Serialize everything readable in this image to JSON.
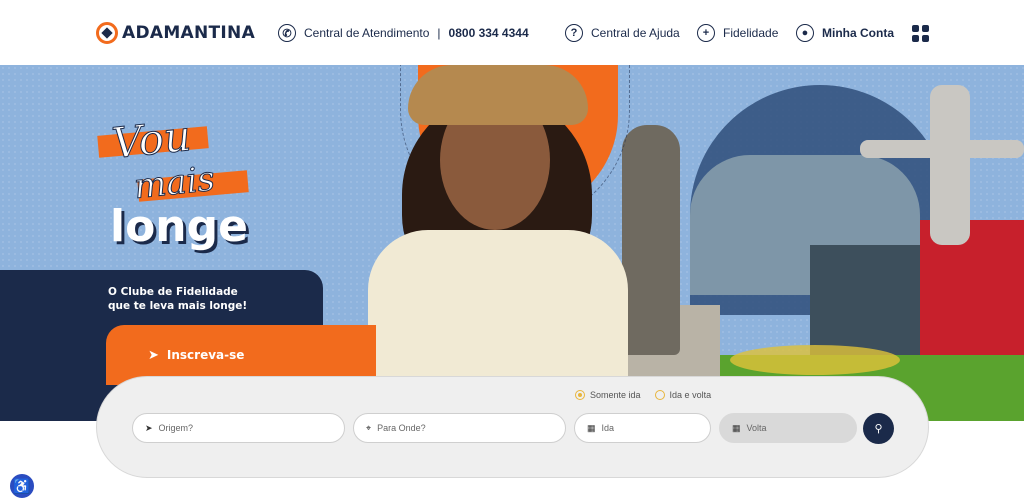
{
  "header": {
    "brand": "ADAMANTINA",
    "contact_label": "Central de Atendimento",
    "contact_phone": "0800 334 4344",
    "help_label": "Central de Ajuda",
    "loyalty_label": "Fidelidade",
    "account_label": "Minha Conta"
  },
  "hero": {
    "headline_line1": "Vou",
    "headline_line2": "mais",
    "headline_line3": "longe",
    "tagline_line1": "O Clube de Fidelidade",
    "tagline_line2": "que te leva mais longe!",
    "cta_label": "Inscreva-se"
  },
  "search": {
    "trip_options": [
      "Somente ida",
      "Ida e volta"
    ],
    "selected_option": "Somente ida",
    "origin_placeholder": "Origem?",
    "destination_placeholder": "Para Onde?",
    "depart_placeholder": "Ida",
    "return_placeholder": "Volta"
  },
  "colors": {
    "navy": "#1b2a4a",
    "orange": "#f26b1d",
    "sky": "#8eb3dd",
    "radio_accent": "#e8b53c"
  },
  "icons": {
    "contact": "whatsapp-icon",
    "help": "help-circle-icon",
    "loyalty": "plus-circle-icon",
    "account": "user-icon",
    "menu": "grid-icon",
    "cta": "send-icon",
    "origin": "navigation-arrow-icon",
    "destination": "map-pin-icon",
    "dates": "calendar-icon",
    "submit": "search-icon",
    "accessibility": "accessibility-icon"
  }
}
